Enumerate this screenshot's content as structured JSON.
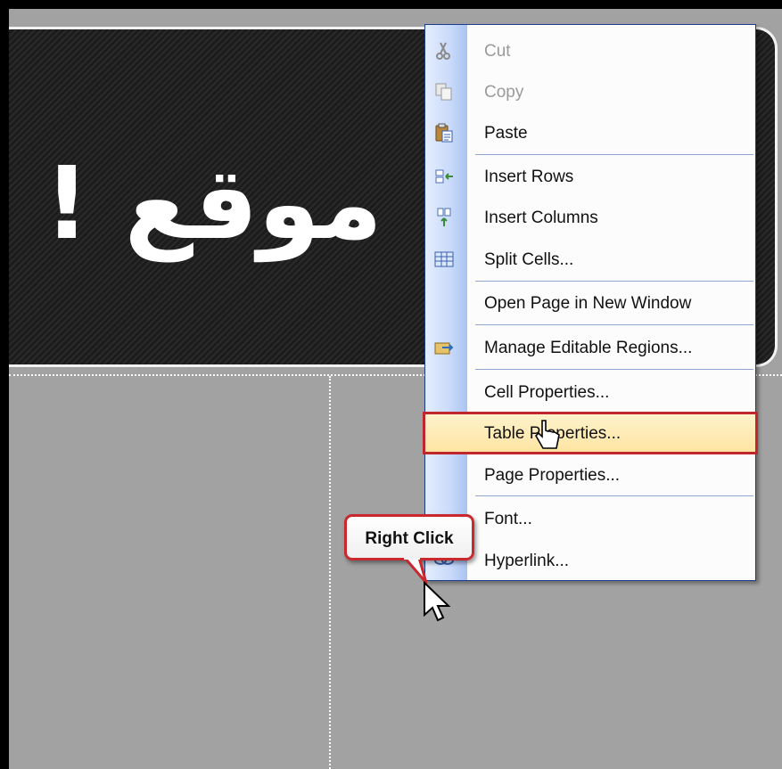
{
  "header": {
    "title": "موقع !"
  },
  "context_menu": {
    "items": [
      {
        "label": "Cut",
        "disabled": true,
        "icon": "scissors-icon"
      },
      {
        "label": "Copy",
        "disabled": true,
        "icon": "copy-icon"
      },
      {
        "label": "Paste",
        "disabled": false,
        "icon": "paste-icon"
      },
      {
        "label": "Insert Rows",
        "disabled": false,
        "icon": "insert-rows-icon"
      },
      {
        "label": "Insert Columns",
        "disabled": false,
        "icon": "insert-columns-icon"
      },
      {
        "label": "Split Cells...",
        "disabled": false,
        "icon": "split-cells-icon"
      },
      {
        "label": "Open Page in New Window",
        "disabled": false,
        "icon": ""
      },
      {
        "label": "Manage Editable Regions...",
        "disabled": false,
        "icon": "editable-regions-icon"
      },
      {
        "label": "Cell Properties...",
        "disabled": false,
        "icon": ""
      },
      {
        "label": "Table Properties...",
        "disabled": false,
        "icon": "",
        "highlighted": true
      },
      {
        "label": "Page Properties...",
        "disabled": false,
        "icon": ""
      },
      {
        "label": "Font...",
        "disabled": false,
        "icon": "font-icon"
      },
      {
        "label": "Hyperlink...",
        "disabled": false,
        "icon": "hyperlink-icon"
      }
    ]
  },
  "callout": {
    "text": "Right Click"
  },
  "colors": {
    "highlight_border": "#c0272d",
    "menu_border": "#1a3d8f",
    "gutter": "#c9dafa"
  }
}
